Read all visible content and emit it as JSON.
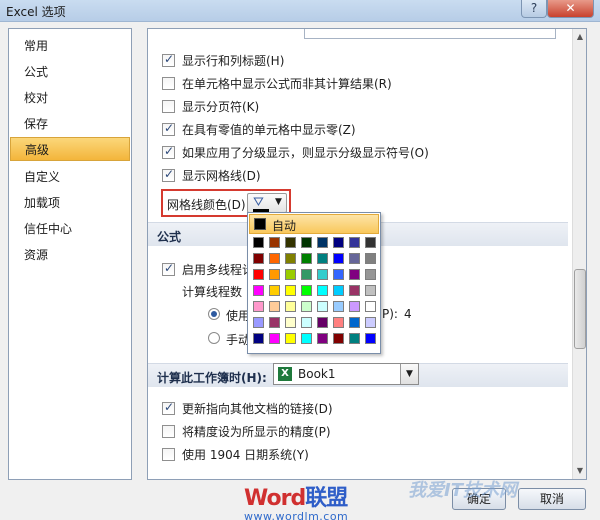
{
  "window": {
    "title": "Excel 选项",
    "help": "?",
    "close": "✕"
  },
  "sidebar": {
    "items": [
      {
        "label": "常用",
        "selected": false
      },
      {
        "label": "公式",
        "selected": false
      },
      {
        "label": "校对",
        "selected": false
      },
      {
        "label": "保存",
        "selected": false
      },
      {
        "label": "高级",
        "selected": true
      },
      {
        "label": "自定义",
        "selected": false
      },
      {
        "label": "加载项",
        "selected": false
      },
      {
        "label": "信任中心",
        "selected": false
      },
      {
        "label": "资源",
        "selected": false
      }
    ]
  },
  "display_options": [
    {
      "label": "显示行和列标题(H)",
      "checked": true
    },
    {
      "label": "在单元格中显示公式而非其计算结果(R)",
      "checked": false
    },
    {
      "label": "显示分页符(K)",
      "checked": false
    },
    {
      "label": "在具有零值的单元格中显示零(Z)",
      "checked": true
    },
    {
      "label": "如果应用了分级显示，则显示分级显示符号(O)",
      "checked": true
    },
    {
      "label": "显示网格线(D)",
      "checked": true
    }
  ],
  "gridline_color": {
    "label": "网格线颜色(D)",
    "value": "#000000"
  },
  "palette": {
    "auto_label": "自动",
    "colors": [
      [
        "#000000",
        "#993300",
        "#333300",
        "#003300",
        "#003366",
        "#000080",
        "#333399",
        "#333333"
      ],
      [
        "#800000",
        "#FF6600",
        "#808000",
        "#008000",
        "#008080",
        "#0000FF",
        "#666699",
        "#808080"
      ],
      [
        "#FF0000",
        "#FF9900",
        "#99CC00",
        "#339966",
        "#33CCCC",
        "#3366FF",
        "#800080",
        "#969696"
      ],
      [
        "#FF00FF",
        "#FFCC00",
        "#FFFF00",
        "#00FF00",
        "#00FFFF",
        "#00CCFF",
        "#993366",
        "#C0C0C0"
      ],
      [
        "#FF99CC",
        "#FFCC99",
        "#FFFF99",
        "#CCFFCC",
        "#CCFFFF",
        "#99CCFF",
        "#CC99FF",
        "#FFFFFF"
      ],
      [
        "#9999FF",
        "#993366",
        "#FFFFCC",
        "#CCFFFF",
        "#660066",
        "#FF8080",
        "#0066CC",
        "#CCCCFF"
      ],
      [
        "#000080",
        "#FF00FF",
        "#FFFF00",
        "#00FFFF",
        "#800080",
        "#800000",
        "#008080",
        "#0000FF"
      ]
    ]
  },
  "formulas": {
    "header": "公式",
    "multithread_label": "启用多线程计",
    "multithread_checked": true,
    "thread_count_label": "计算线程数",
    "radio_use_label": "使用",
    "radio_use_checked": true,
    "radio_use_suffix": "P):",
    "radio_use_value": "4",
    "radio_manual_label": "手动",
    "radio_manual_checked": false
  },
  "calc_workbook": {
    "label": "计算此工作簿时(H):",
    "value": "Book1",
    "options": [
      {
        "label": "更新指向其他文档的链接(D)",
        "checked": true
      },
      {
        "label": "将精度设为所显示的精度(P)",
        "checked": false
      },
      {
        "label": "使用 1904 日期系统(Y)",
        "checked": false
      }
    ]
  },
  "footer": {
    "ok": "确定",
    "cancel": "取消"
  },
  "watermark": {
    "word": "Word",
    "brand": "联盟",
    "url": "www.wordlm.com",
    "right_mark": "我爱IT技术网"
  }
}
